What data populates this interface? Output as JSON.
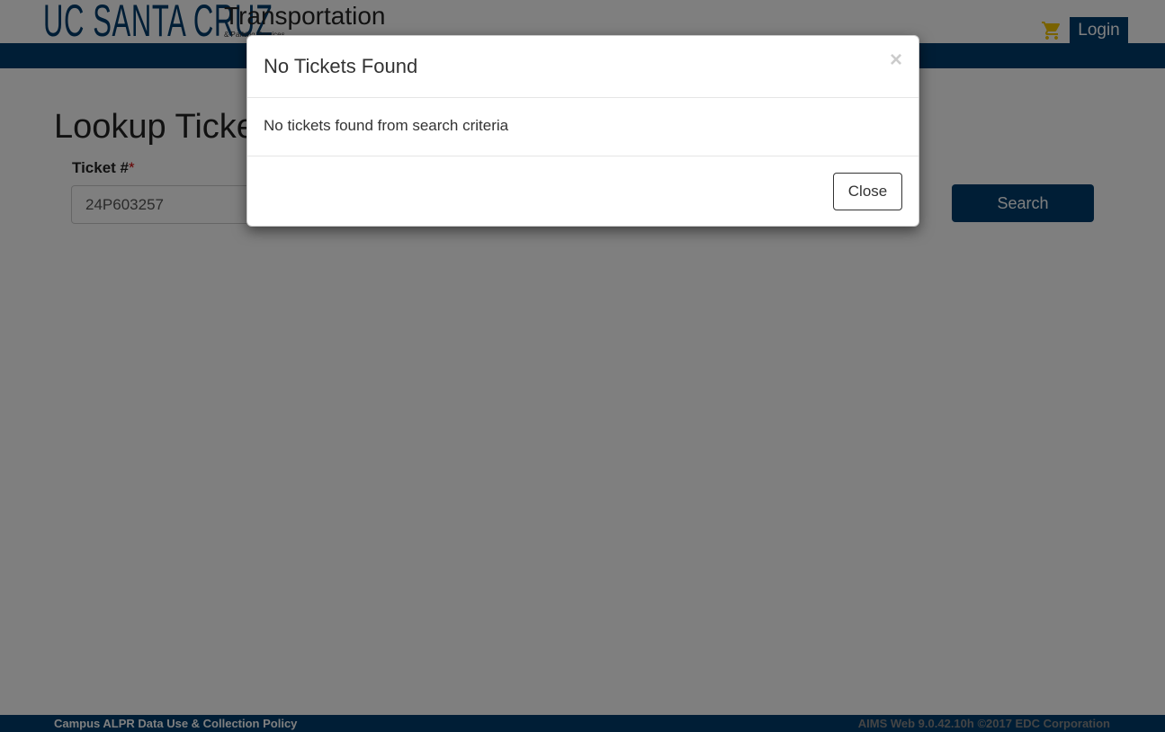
{
  "header": {
    "logo_text": "UC SANTA CRUZ",
    "brand_title": "Transportation",
    "brand_subtitle": "& Parking Services",
    "cart_icon": "shopping-cart-icon",
    "login_label": "Login"
  },
  "main": {
    "page_title": "Lookup Tickets",
    "ticket_label": "Ticket #",
    "required_mark": "*",
    "ticket_value": "24P603257",
    "search_label": "Search"
  },
  "modal": {
    "title": "No Tickets Found",
    "close_x": "×",
    "body": "No tickets found from search criteria",
    "close_label": "Close"
  },
  "footer": {
    "policy_link": "Campus ALPR Data Use & Collection Policy",
    "version": "AIMS Web 9.0.42.10h ©2017 EDC Corporation"
  },
  "colors": {
    "brand_navy": "#003c6c",
    "cart_gold": "#f2c500"
  }
}
